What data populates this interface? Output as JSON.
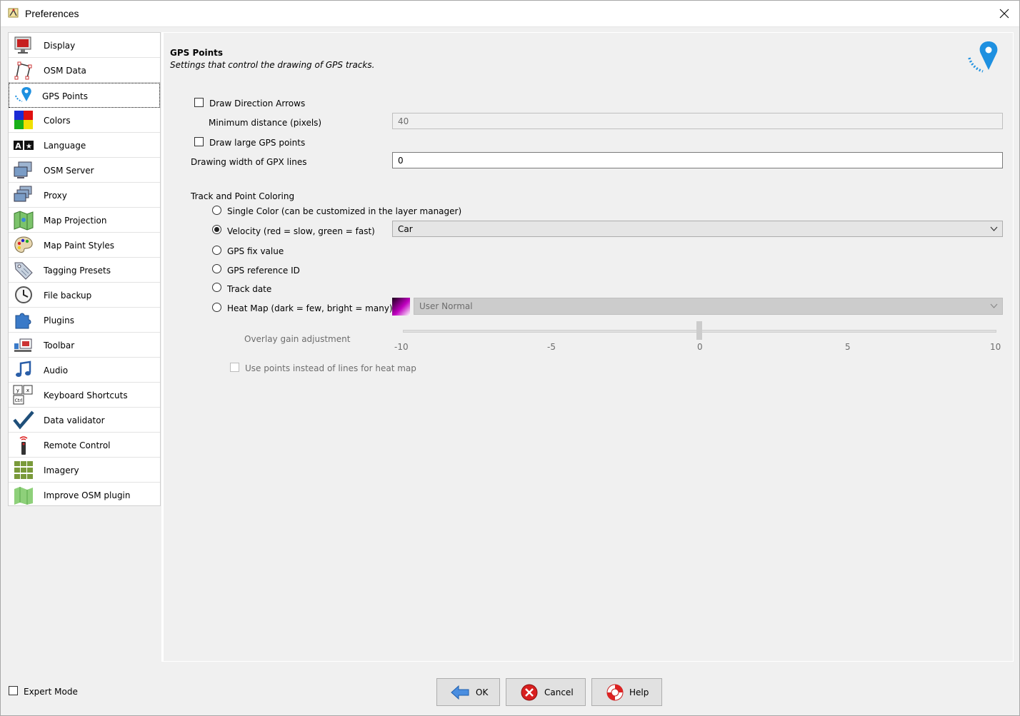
{
  "window": {
    "title": "Preferences",
    "close_icon": "close-icon"
  },
  "sidebar": {
    "items": [
      {
        "label": "Display",
        "icon": "display-icon"
      },
      {
        "label": "OSM Data",
        "icon": "osm-data-icon"
      },
      {
        "label": "GPS Points",
        "icon": "gps-pin-icon",
        "selected": true
      },
      {
        "label": "Colors",
        "icon": "colors-icon"
      },
      {
        "label": "Language",
        "icon": "language-icon"
      },
      {
        "label": "OSM Server",
        "icon": "osm-server-icon"
      },
      {
        "label": "Proxy",
        "icon": "proxy-icon"
      },
      {
        "label": "Map Projection",
        "icon": "map-projection-icon"
      },
      {
        "label": "Map Paint Styles",
        "icon": "palette-icon"
      },
      {
        "label": "Tagging Presets",
        "icon": "tag-icon"
      },
      {
        "label": "File backup",
        "icon": "clock-icon"
      },
      {
        "label": "Plugins",
        "icon": "puzzle-icon"
      },
      {
        "label": "Toolbar",
        "icon": "toolbar-icon"
      },
      {
        "label": "Audio",
        "icon": "music-note-icon"
      },
      {
        "label": "Keyboard Shortcuts",
        "icon": "keyboard-icon"
      },
      {
        "label": "Data validator",
        "icon": "checkmark-icon"
      },
      {
        "label": "Remote Control",
        "icon": "remote-control-icon"
      },
      {
        "label": "Imagery",
        "icon": "imagery-grid-icon"
      },
      {
        "label": "Improve OSM plugin",
        "icon": "improve-osm-icon"
      }
    ]
  },
  "panel": {
    "title": "GPS Points",
    "subtitle": "Settings that control the drawing of GPS tracks.",
    "header_icon": "gps-pin-icon",
    "draw_direction_arrows": {
      "label": "Draw Direction Arrows",
      "checked": false
    },
    "min_distance": {
      "label": "Minimum distance (pixels)",
      "value": "40",
      "enabled": false
    },
    "draw_large_points": {
      "label": "Draw large GPS points",
      "checked": false
    },
    "gpx_line_width": {
      "label": "Drawing width of GPX lines",
      "value": "0"
    },
    "coloring": {
      "section_label": "Track and Point Coloring",
      "options": [
        {
          "label": "Single Color (can be customized in the layer manager)",
          "checked": false
        },
        {
          "label": "Velocity (red = slow, green = fast)",
          "checked": true
        },
        {
          "label": "GPS fix value",
          "checked": false
        },
        {
          "label": "GPS reference ID",
          "checked": false
        },
        {
          "label": "Track date",
          "checked": false
        },
        {
          "label": "Heat Map (dark = few, bright = many)",
          "checked": false
        }
      ],
      "velocity_select": {
        "value": "Car"
      },
      "heatmap_select": {
        "value": "User Normal",
        "enabled": false
      }
    },
    "overlay_gain": {
      "label": "Overlay gain adjustment",
      "ticks": [
        "-10",
        "-5",
        "0",
        "5",
        "10"
      ],
      "min": -10,
      "max": 10,
      "value": 0
    },
    "heatmap_points": {
      "label": "Use points instead of lines for heat map",
      "checked": false,
      "enabled": false
    }
  },
  "footer": {
    "expert_mode": {
      "label": "Expert Mode",
      "checked": false
    },
    "ok": {
      "label": "OK",
      "icon": "ok-arrow-icon"
    },
    "cancel": {
      "label": "Cancel",
      "icon": "cancel-icon"
    },
    "help": {
      "label": "Help",
      "icon": "help-lifebuoy-icon"
    }
  },
  "colors": {
    "accent_blue": "#1e90e0",
    "heatmap_swatch": "#c000c0"
  }
}
